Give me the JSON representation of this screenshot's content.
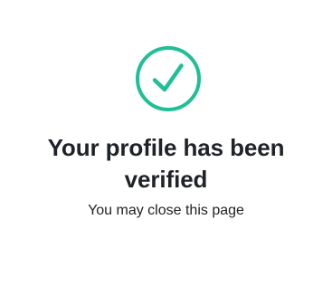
{
  "status": {
    "icon": "check-circle-icon",
    "accent_color": "#1fbf97",
    "title": "Your profile has been verified",
    "message": "You may close this page"
  }
}
